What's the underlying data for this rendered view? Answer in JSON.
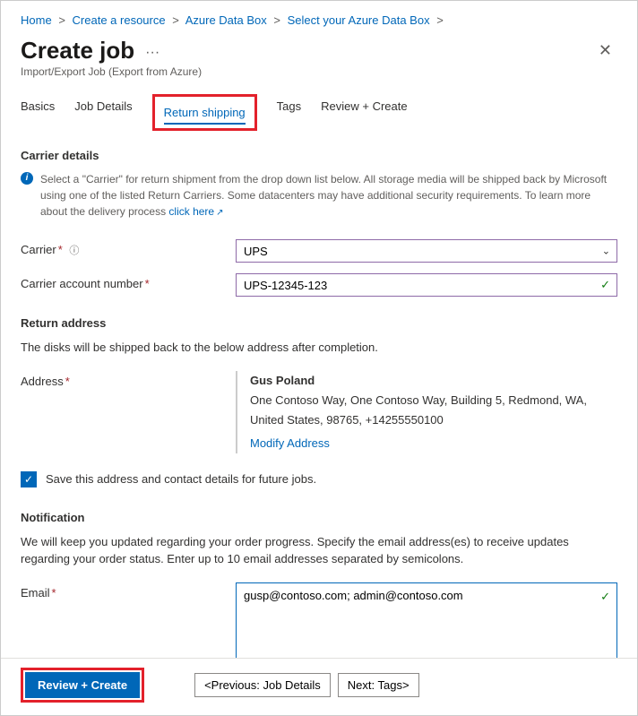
{
  "breadcrumb": {
    "items": [
      "Home",
      "Create a resource",
      "Azure Data Box",
      "Select your Azure Data Box"
    ]
  },
  "header": {
    "title": "Create job",
    "subtitle": "Import/Export Job (Export from Azure)"
  },
  "tabs": {
    "basics": "Basics",
    "jobDetails": "Job Details",
    "returnShipping": "Return shipping",
    "tags": "Tags",
    "reviewCreate": "Review + Create"
  },
  "carrierDetails": {
    "title": "Carrier details",
    "info": "Select a \"Carrier\" for return shipment from the drop down list below. All storage media will be shipped back by Microsoft using one of the listed Return Carriers. Some datacenters may have additional security requirements. To learn more about the delivery process ",
    "infoLink": "click here",
    "carrierLabel": "Carrier",
    "carrierValue": "UPS",
    "accountLabel": "Carrier account number",
    "accountValue": "UPS-12345-123"
  },
  "returnAddress": {
    "title": "Return address",
    "desc": "The disks will be shipped back to the below address after completion.",
    "addressLabel": "Address",
    "name": "Gus Poland",
    "full": "One Contoso Way, One Contoso Way, Building 5, Redmond, WA, United States, 98765, +14255550100",
    "modify": "Modify Address",
    "saveCheckbox": "Save this address and contact details for future jobs."
  },
  "notification": {
    "title": "Notification",
    "desc": "We will keep you updated regarding your order progress. Specify the email address(es) to receive updates regarding your order status. Enter up to 10 email addresses separated by semicolons.",
    "emailLabel": "Email",
    "emailValue": "gusp@contoso.com; admin@contoso.com"
  },
  "footer": {
    "reviewCreate": "Review + Create",
    "previous": "<Previous: Job Details",
    "next": "Next: Tags>"
  }
}
